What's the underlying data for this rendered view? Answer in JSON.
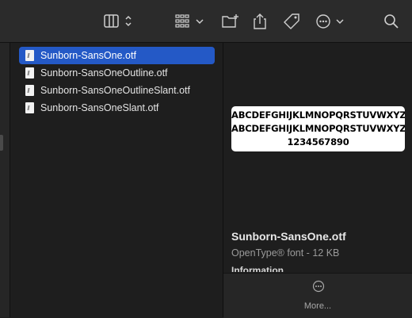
{
  "toolbar": {
    "buttons": [
      {
        "name": "view-columns-button",
        "icon": "columns-icon"
      },
      {
        "name": "group-button",
        "icon": "grid-icon"
      },
      {
        "name": "new-folder-button",
        "icon": "folder-add-icon"
      },
      {
        "name": "share-button",
        "icon": "share-icon"
      },
      {
        "name": "tag-button",
        "icon": "tag-icon"
      },
      {
        "name": "action-button",
        "icon": "ellipsis-circle-icon"
      },
      {
        "name": "search-button",
        "icon": "search-icon"
      }
    ]
  },
  "files": [
    {
      "label": "Sunborn-SansOne.otf",
      "selected": true
    },
    {
      "label": "Sunborn-SansOneOutline.otf",
      "selected": false
    },
    {
      "label": "Sunborn-SansOneOutlineSlant.otf",
      "selected": false
    },
    {
      "label": "Sunborn-SansOneSlant.otf",
      "selected": false
    }
  ],
  "preview": {
    "sample_lines": [
      "ABCDEFGHIJKLMNOPQRSTUVWXYZ",
      "ABCDEFGHIJKLMNOPQRSTUVWXYZ",
      "1234567890"
    ],
    "name": "Sunborn-SansOne.otf",
    "kind": "OpenType® font - 12 KB",
    "info_heading": "Information",
    "more_label": "More..."
  },
  "colors": {
    "selection": "#2459c6",
    "background": "#1e1e1e",
    "toolbar": "#2b2b2b"
  }
}
